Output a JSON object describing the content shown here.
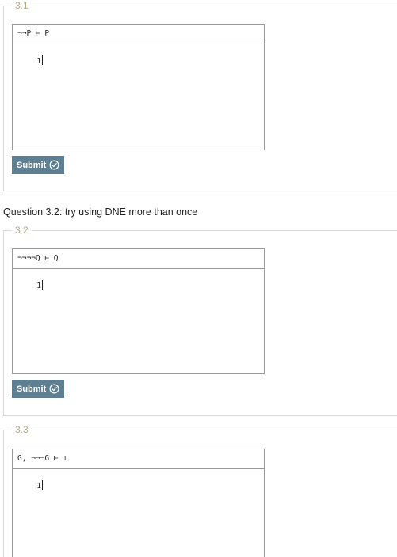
{
  "questions": [
    {
      "legend": "3.1",
      "goal": "¬¬P ⊢ P",
      "line_number": "1",
      "submit_label": "Submit"
    },
    {
      "legend": "3.2",
      "prompt": "Question 3.2: try using DNE more than once",
      "goal": "¬¬¬¬Q ⊢ Q",
      "line_number": "1",
      "submit_label": "Submit"
    },
    {
      "legend": "3.3",
      "goal": "G, ¬¬¬G ⊢ ⊥",
      "line_number": "1"
    }
  ],
  "colors": {
    "submit_bg": "#5e7f92",
    "legend": "#b3a98c",
    "border": "#9a9a9a"
  },
  "icons": {
    "submit": "check-circle-icon"
  }
}
